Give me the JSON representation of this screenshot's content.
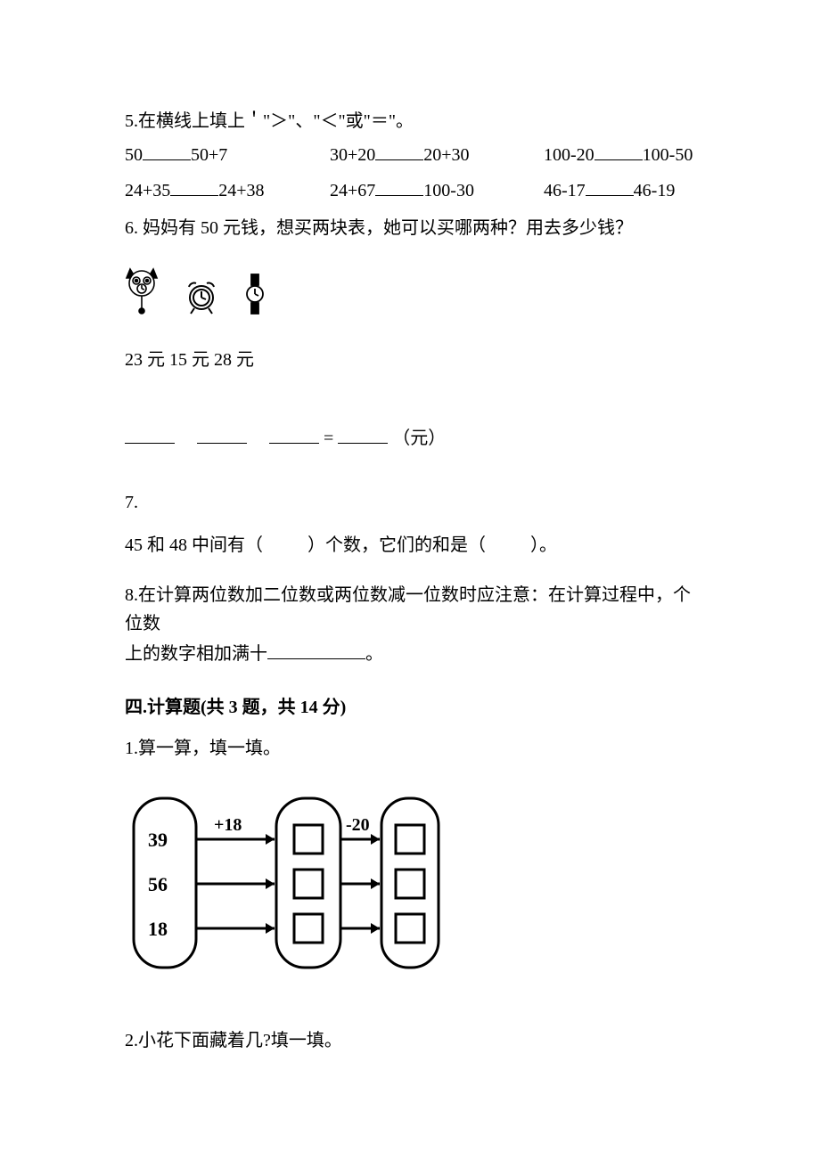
{
  "q5": {
    "title": "5.在横线上填上＇\"＞\"、\"＜\"或\"＝\"。",
    "row1": {
      "a": "50",
      "b": "50+7",
      "c": "30+20",
      "d": "20+30",
      "e": "100-20",
      "f": "100-50"
    },
    "row2": {
      "a": "24+35",
      "b": "24+38",
      "c": "24+67",
      "d": "100-30",
      "e": "46-17",
      "f": "46-19"
    }
  },
  "q6": {
    "title": "6. 妈妈有 50 元钱，想买两块表，她可以买哪两种？用去多少钱？",
    "prices": "23 元   15 元   28 元",
    "eq_tail": " =  ",
    "unit": "（元）"
  },
  "q7": {
    "title": "7. ",
    "body_a": "45 和 48 中间有（",
    "body_b": "）个数，它们的和是（",
    "body_c": "）。"
  },
  "q8": {
    "line1": "8.在计算两位数加二位数或两位数减一位数时应注意：在计算过程中，个位数",
    "line2_a": "上的数字相加满十",
    "line2_b": "。"
  },
  "sec4": {
    "title": "四.计算题(共 3 题，共 14 分)",
    "q1": "1.算一算，填一填。",
    "q2": "2.小花下面藏着几?填一填。",
    "diagram": {
      "inputs": [
        "39",
        "56",
        "18"
      ],
      "op1": "+18",
      "op2": "-20"
    }
  }
}
